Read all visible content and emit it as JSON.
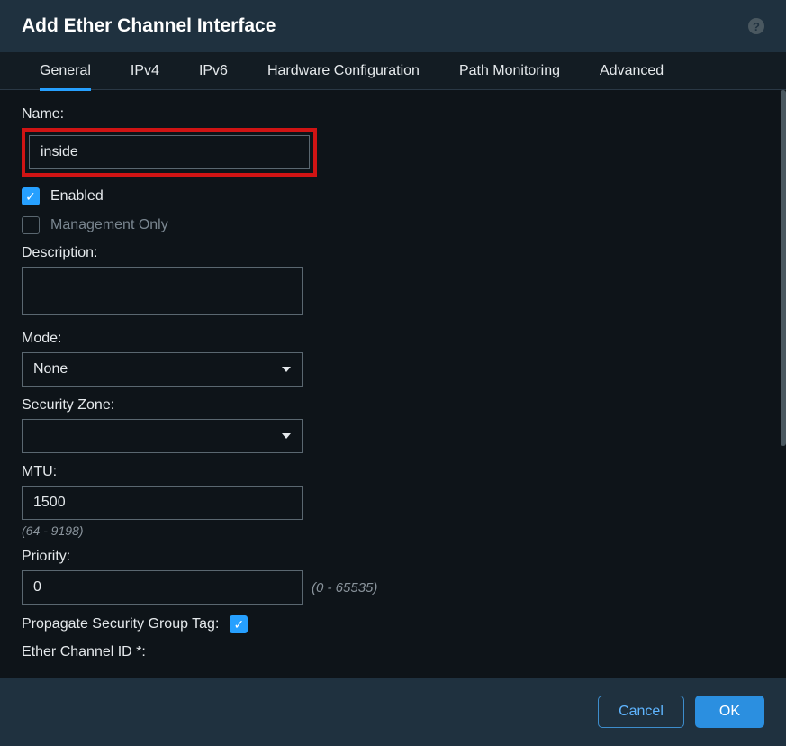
{
  "title": "Add Ether Channel Interface",
  "tabs": {
    "general": "General",
    "ipv4": "IPv4",
    "ipv6": "IPv6",
    "hardware": "Hardware Configuration",
    "pathmon": "Path Monitoring",
    "advanced": "Advanced"
  },
  "fields": {
    "name_label": "Name:",
    "name_value": "inside",
    "enabled_label": "Enabled",
    "mgmt_only_label": "Management Only",
    "description_label": "Description:",
    "description_value": "",
    "mode_label": "Mode:",
    "mode_value": "None",
    "security_zone_label": "Security Zone:",
    "security_zone_value": "",
    "mtu_label": "MTU:",
    "mtu_value": "1500",
    "mtu_hint": "(64 - 9198)",
    "priority_label": "Priority:",
    "priority_value": "0",
    "priority_hint": "(0 - 65535)",
    "propagate_label": "Propagate Security Group Tag:",
    "etherchannel_id_label": "Ether Channel ID *:"
  },
  "footer": {
    "cancel": "Cancel",
    "ok": "OK"
  }
}
